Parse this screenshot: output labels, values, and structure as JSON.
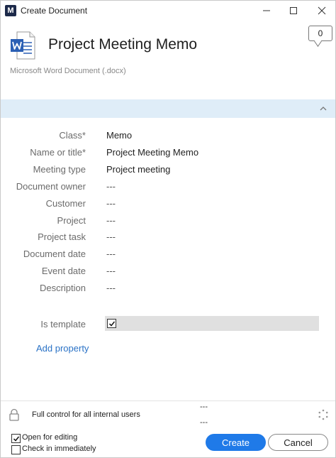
{
  "window": {
    "logo_letter": "M",
    "title": "Create Document"
  },
  "comment_count": "0",
  "document": {
    "title": "Project Meeting Memo",
    "type": "Microsoft Word Document (.docx)"
  },
  "properties": [
    {
      "label": "Class*",
      "value": "Memo"
    },
    {
      "label": "Name or title*",
      "value": "Project Meeting Memo"
    },
    {
      "label": "Meeting type",
      "value": "Project meeting"
    },
    {
      "label": "Document owner",
      "value": "---"
    },
    {
      "label": "Customer",
      "value": "---"
    },
    {
      "label": "Project",
      "value": "---"
    },
    {
      "label": "Project task",
      "value": "---"
    },
    {
      "label": "Document date",
      "value": "---"
    },
    {
      "label": "Event date",
      "value": "---"
    },
    {
      "label": "Description",
      "value": "---"
    }
  ],
  "is_template": {
    "label": "Is template",
    "checked": true
  },
  "add_property_label": "Add property",
  "permissions": {
    "text": "Full control for all internal users",
    "dash_top": "---",
    "dash_bottom": "---"
  },
  "options": {
    "open_for_editing": {
      "label": "Open for editing",
      "checked": true
    },
    "check_in_immediately": {
      "label": "Check in immediately",
      "checked": false
    }
  },
  "buttons": {
    "create": "Create",
    "cancel": "Cancel"
  },
  "colors": {
    "accent": "#1f7ae8",
    "band": "#dfedf8",
    "link": "#2a72c6",
    "word_blue": "#2b5fb4"
  }
}
